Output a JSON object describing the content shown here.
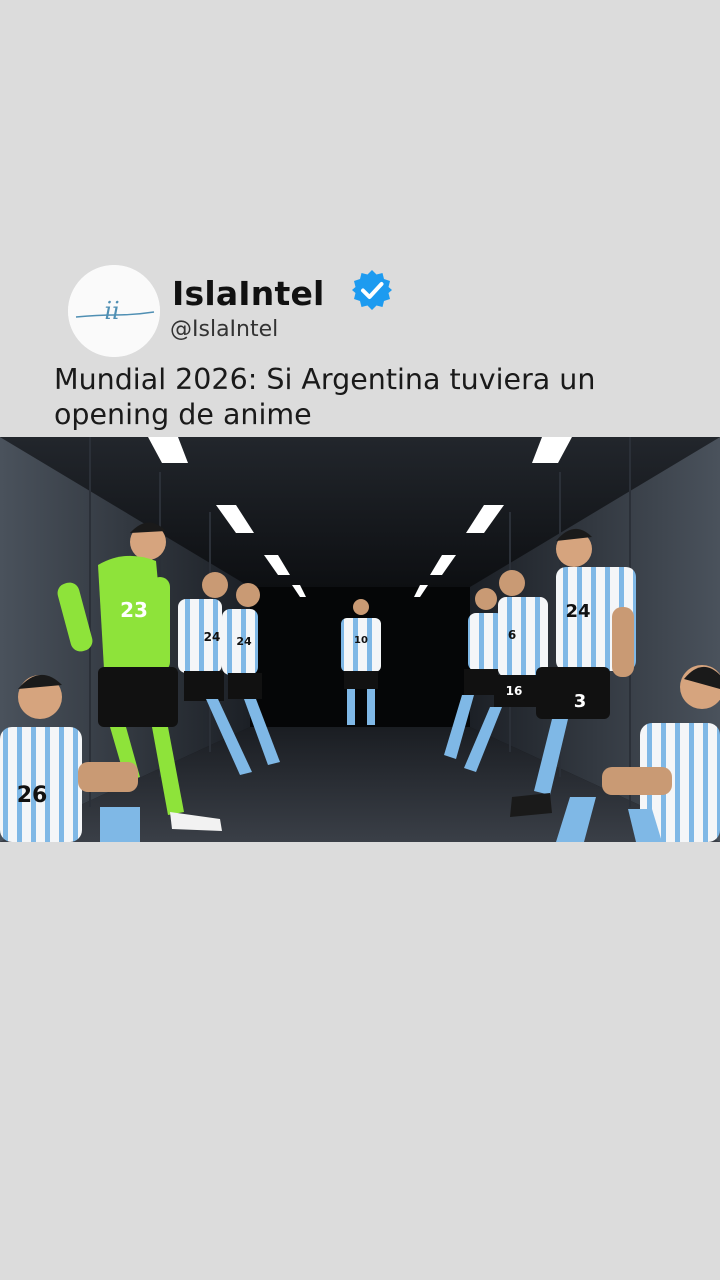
{
  "post": {
    "author_name": "IslaIntel",
    "author_handle": "@IslaIntel",
    "verified": true,
    "headline": "Mundial 2026: Si Argentina tuviera un opening de anime",
    "avatar_logo_text": "ii"
  },
  "image": {
    "jersey_numbers": [
      "23",
      "24",
      "24",
      "10",
      "6",
      "16",
      "24",
      "3",
      "26"
    ]
  },
  "colors": {
    "background": "#dcdcdc",
    "verified_badge": "#1d9bf0",
    "argentina_sky_blue": "#7fb8e6",
    "goalkeeper_green": "#8ee33a"
  }
}
